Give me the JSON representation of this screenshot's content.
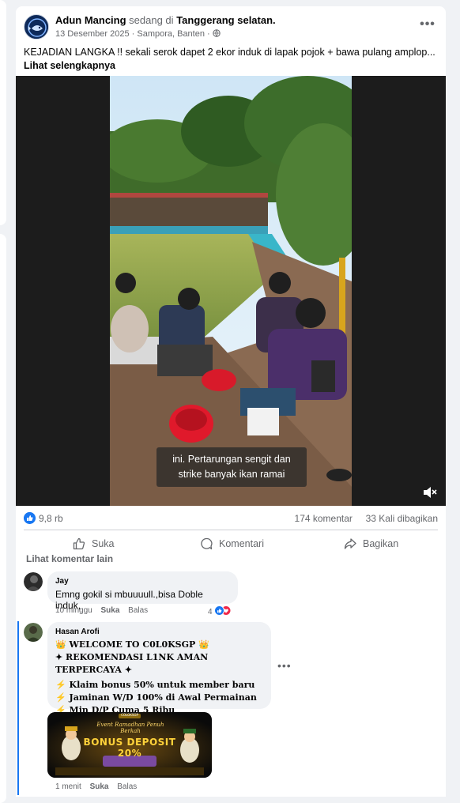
{
  "post": {
    "author": "Adun Mancing",
    "status_text": "sedang di",
    "place": "Tanggerang selatan.",
    "date": "13 Desember 2025",
    "location": "Sampora, Banten",
    "caption": "KEJADIAN LANGKA !! sekali serok dapet 2 ekor induk di lapak pojok + bawa pulang amplop...",
    "see_more": "Lihat selengkapnya",
    "more_label": "•••"
  },
  "video": {
    "subtitle_line1": "ini. Pertarungan sengit dan",
    "subtitle_line2": "strike banyak ikan ramai"
  },
  "stats": {
    "reactions": "9,8 rb",
    "comments": "174 komentar",
    "shares": "33 Kali dibagikan"
  },
  "actions": {
    "like": "Suka",
    "comment": "Komentari",
    "share": "Bagikan"
  },
  "comments": {
    "see_more": "Lihat komentar lain",
    "items": [
      {
        "name": "Jay",
        "text": "Emng gokil si mbuuuull.,bisa Doble induk,",
        "time": "10 minggu",
        "like": "Suka",
        "reply": "Balas",
        "reaction_count": "4"
      },
      {
        "name": "Hasan Arofi",
        "lines": [
          "👑 WELCOME TO C0L0KSGP 👑",
          "✦ REKOMENDASI L1NK AMAN TERPERCAYA ✦",
          "⚡ Klaim bonus 50% untuk member baru",
          "⚡ Jaminan W/D 100% di Awal Permainan",
          "⚡ Min D/P Cuma 5 Ribu"
        ],
        "promo_top": "Event Ramadhan Penuh Berkah",
        "promo_title": "BONUS DEPOSIT 20%",
        "promo_badge": "COLOKSGP",
        "time": "1 menit",
        "like": "Suka",
        "reply": "Balas",
        "more_label": "•••"
      }
    ]
  },
  "colors": {
    "brand_blue": "#1877f2",
    "muted": "#65676b",
    "bubble": "#f0f2f5"
  }
}
